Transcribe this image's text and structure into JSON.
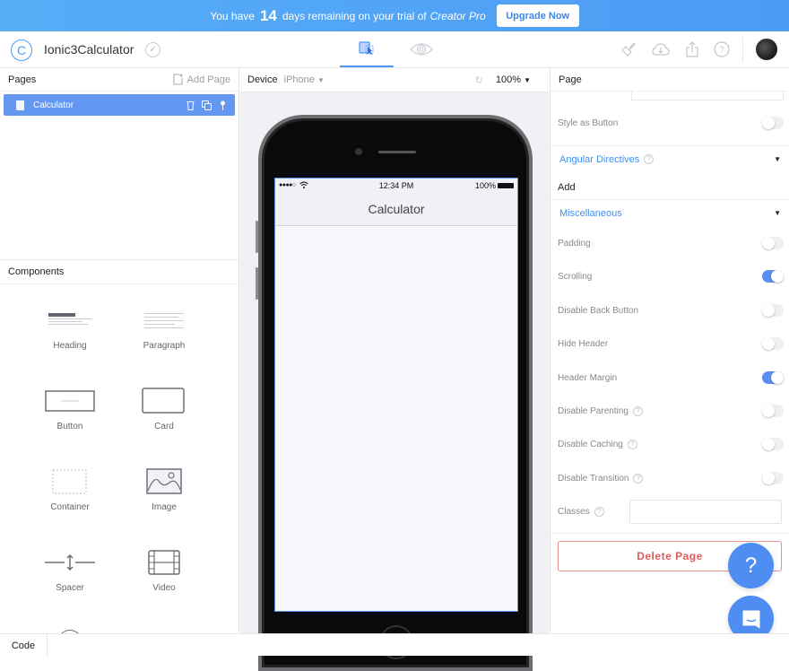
{
  "banner": {
    "prefix": "You have",
    "days": "14",
    "middle": "days remaining on your trial of",
    "product": "Creator Pro",
    "upgrade_label": "Upgrade Now"
  },
  "topbar": {
    "app_title": "Ionic3Calculator",
    "logo_glyph": "C",
    "view_tabs": [
      {
        "name": "design-icon",
        "active": true
      },
      {
        "name": "preview-eye-icon",
        "active": false
      }
    ],
    "tools": [
      "theme-brush-icon",
      "cloud-download-icon",
      "share-export-icon",
      "help-icon"
    ]
  },
  "pages_panel": {
    "title": "Pages",
    "add_label": "Add Page",
    "items": [
      {
        "label": "Calculator",
        "selected": true
      }
    ]
  },
  "components_panel": {
    "title": "Components",
    "items": [
      {
        "label": "Heading",
        "icon": "heading-icon"
      },
      {
        "label": "Paragraph",
        "icon": "paragraph-icon"
      },
      {
        "label": "Button",
        "icon": "button-icon"
      },
      {
        "label": "Card",
        "icon": "card-icon"
      },
      {
        "label": "Container",
        "icon": "container-icon"
      },
      {
        "label": "Image",
        "icon": "image-icon"
      },
      {
        "label": "Spacer",
        "icon": "spacer-icon"
      },
      {
        "label": "Video",
        "icon": "video-icon"
      }
    ]
  },
  "device_bar": {
    "device_label": "Device",
    "device_value": "iPhone",
    "zoom_value": "100%"
  },
  "phone": {
    "carrier_dots": "●●●●○",
    "wifi": "ᯤ",
    "time": "12:34 PM",
    "battery": "100%",
    "nav_title": "Calculator"
  },
  "properties": {
    "title": "Page",
    "style_as_button": {
      "label": "Style as Button",
      "on": false
    },
    "angular_directives": {
      "label": "Angular Directives",
      "add_label": "Add"
    },
    "miscellaneous": {
      "label": "Miscellaneous"
    },
    "toggles": [
      {
        "label": "Padding",
        "on": false,
        "help": false
      },
      {
        "label": "Scrolling",
        "on": true,
        "help": false
      },
      {
        "label": "Disable Back Button",
        "on": false,
        "help": false
      },
      {
        "label": "Hide Header",
        "on": false,
        "help": false
      },
      {
        "label": "Header Margin",
        "on": true,
        "help": false
      },
      {
        "label": "Disable Parenting",
        "on": false,
        "help": true
      },
      {
        "label": "Disable Caching",
        "on": false,
        "help": true
      },
      {
        "label": "Disable Transition",
        "on": false,
        "help": true
      }
    ],
    "classes_label": "Classes",
    "classes_value": "",
    "delete_label": "Delete Page"
  },
  "fab": {
    "help_glyph": "?"
  },
  "bottombar": {
    "code_label": "Code"
  },
  "colors": {
    "accent": "#4d9af5",
    "selected_row": "#6497f2",
    "danger": "#df5a5a",
    "toggle_on": "#5a8ef0"
  }
}
